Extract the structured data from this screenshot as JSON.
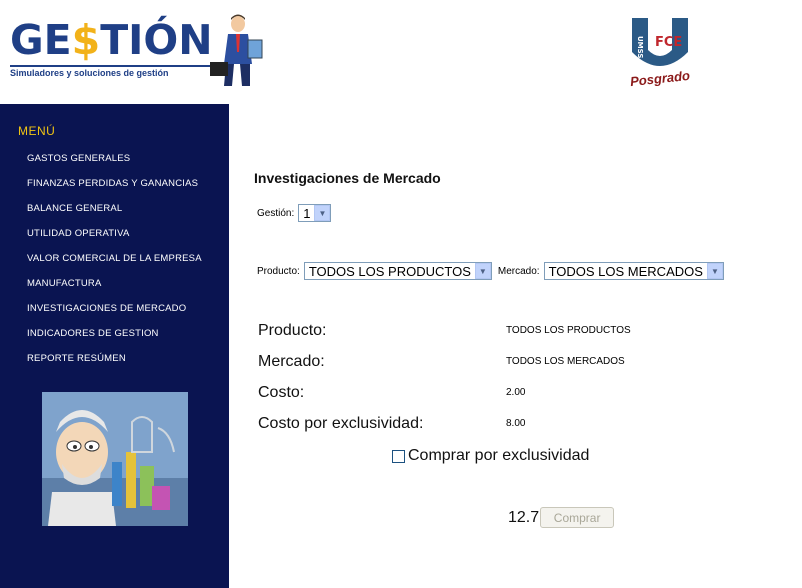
{
  "header": {
    "logo": {
      "word_start": "GE",
      "word_dollar": "$",
      "word_end": "TIÓN",
      "tagline": "Simuladores y soluciones de gestión"
    },
    "badge": {
      "label": "Posgrado",
      "letters_left": "UMSS",
      "letters_right": "FCE"
    }
  },
  "sidebar": {
    "title": "MENÚ",
    "items": [
      "GASTOS GENERALES",
      "FINANZAS PERDIDAS Y GANANCIAS",
      "BALANCE GENERAL",
      "UTILIDAD OPERATIVA",
      "VALOR COMERCIAL DE LA EMPRESA",
      "MANUFACTURA",
      "INVESTIGACIONES DE MERCADO",
      "INDICADORES DE GESTION",
      "REPORTE RESÚMEN"
    ]
  },
  "main": {
    "title": "Investigaciones de Mercado",
    "gestion": {
      "label": "Gestión:",
      "value": "1"
    },
    "producto_filter": {
      "label": "Producto:",
      "value": "TODOS LOS PRODUCTOS"
    },
    "mercado_filter": {
      "label": "Mercado:",
      "value": "TODOS LOS MERCADOS"
    },
    "info": {
      "producto_label": "Producto:",
      "producto_value": "TODOS LOS PRODUCTOS",
      "mercado_label": "Mercado:",
      "mercado_value": "TODOS LOS MERCADOS",
      "costo_label": "Costo:",
      "costo_value": "2.00",
      "excl_label": "Costo por exclusividad:",
      "excl_value": "8.00"
    },
    "exclusividad_checkbox": {
      "label": "Comprar por exclusividad",
      "checked": false
    },
    "price": "12.7",
    "buy_button": "Comprar"
  }
}
